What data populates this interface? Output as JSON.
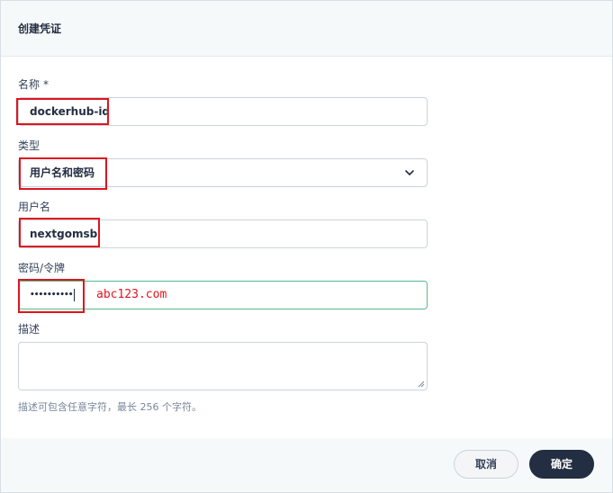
{
  "dialog": {
    "title": "创建凭证"
  },
  "form": {
    "name": {
      "label": "名称",
      "required_mark": "*",
      "value": "dockerhub-id"
    },
    "type": {
      "label": "类型",
      "selected": "用户名和密码"
    },
    "username": {
      "label": "用户名",
      "value": "nextgomsb"
    },
    "password": {
      "label": "密码/令牌",
      "masked_value": "••••••••••"
    },
    "description": {
      "label": "描述",
      "value": "",
      "hint": "描述可包含任意字符，最长 256 个字符。"
    }
  },
  "annotation": {
    "password_note": "abc123.com",
    "color": "#e0141e"
  },
  "footer": {
    "cancel_label": "取消",
    "ok_label": "确定"
  },
  "colors": {
    "primary_dark": "#242e42",
    "focus_border": "#55bc8a",
    "header_bg": "#f6f9fa"
  },
  "icons": {
    "select_chevron": "chevron-down-icon",
    "textarea_resize": "resize-grip-icon"
  }
}
